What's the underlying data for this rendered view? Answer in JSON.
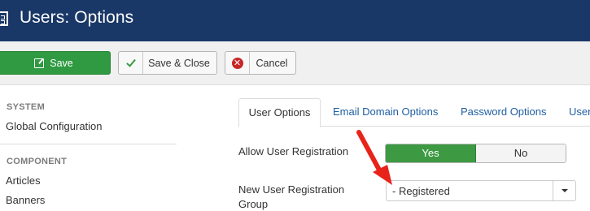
{
  "header": {
    "title": "Users: Options",
    "icon": "options-icon"
  },
  "toolbar": {
    "save_label": "Save",
    "save_close_label": "Save & Close",
    "cancel_label": "Cancel"
  },
  "sidebar": {
    "sections": [
      {
        "heading": "SYSTEM",
        "items": [
          "Global Configuration"
        ]
      },
      {
        "heading": "COMPONENT",
        "items": [
          "Articles",
          "Banners"
        ]
      }
    ]
  },
  "tabs": [
    {
      "label": "User Options",
      "active": true
    },
    {
      "label": "Email Domain Options",
      "active": false
    },
    {
      "label": "Password Options",
      "active": false
    },
    {
      "label": "User",
      "active": false
    }
  ],
  "form": {
    "allow_registration": {
      "label": "Allow User Registration",
      "yes_label": "Yes",
      "no_label": "No",
      "selected": "Yes"
    },
    "registration_group": {
      "label_line1": "New User Registration",
      "label_line2": "Group",
      "value": "- Registered"
    }
  },
  "colors": {
    "header_bg": "#1a3867",
    "save_green": "#2f9a41",
    "toggle_yes": "#3d9a43",
    "cancel_red": "#c52827",
    "link_blue": "#1f5fa2",
    "annotation_arrow": "#e8231a"
  }
}
